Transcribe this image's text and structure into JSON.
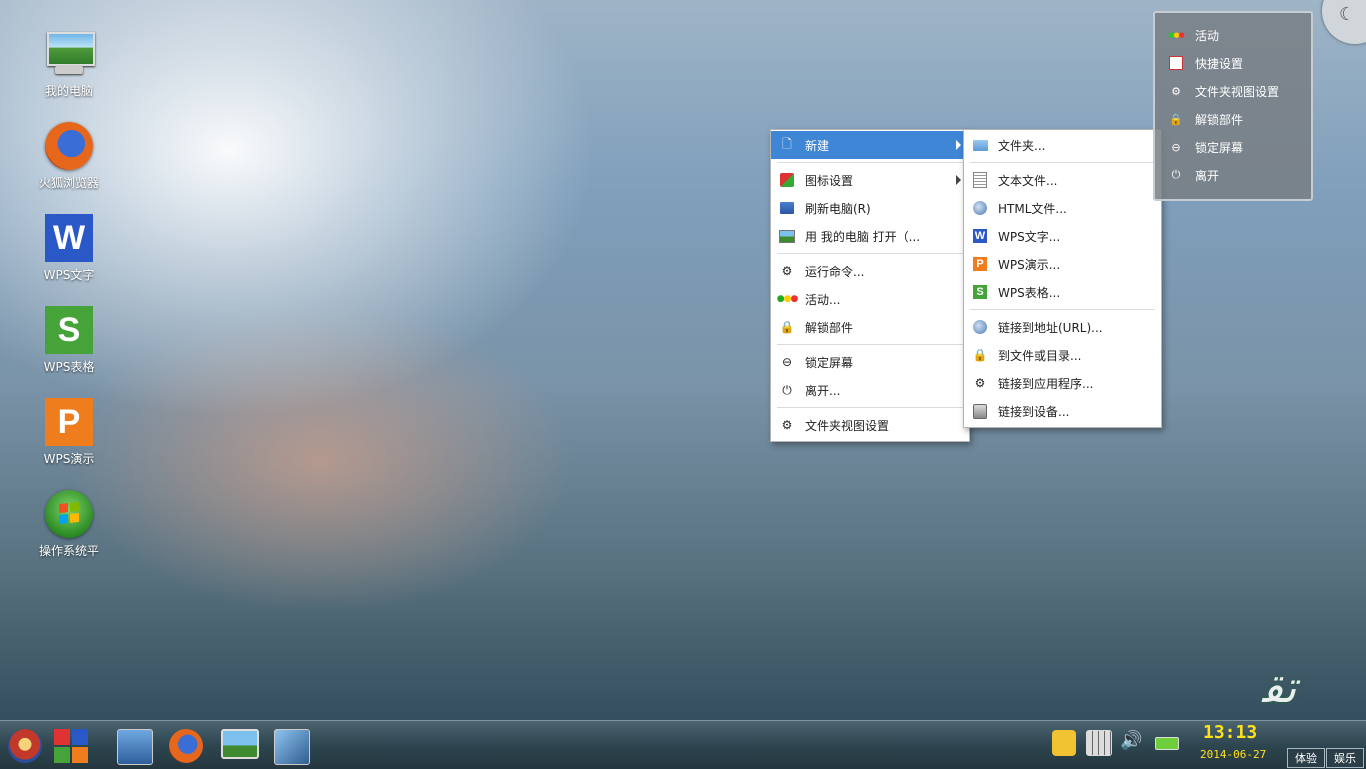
{
  "desktop": {
    "icons": [
      {
        "label": "我的电脑"
      },
      {
        "label": "火狐浏览器"
      },
      {
        "label": "WPS文字",
        "glyph": "W"
      },
      {
        "label": "WPS表格",
        "glyph": "S"
      },
      {
        "label": "WPS演示",
        "glyph": "P"
      },
      {
        "label": "操作系统平"
      }
    ]
  },
  "context_menu": {
    "items": [
      {
        "label": "新建",
        "icon": "new-doc-icon",
        "submenu": true,
        "active": true
      },
      {
        "label": "图标设置",
        "icon": "icon-settings-icon",
        "submenu": true
      },
      {
        "label": "刷新电脑(R)",
        "icon": "refresh-icon"
      },
      {
        "label": "用 我的电脑 打开（...",
        "icon": "monitor-icon"
      },
      {
        "label": "运行命令...",
        "icon": "gear-icon"
      },
      {
        "label": "活动...",
        "icon": "activity-dots-icon"
      },
      {
        "label": "解锁部件",
        "icon": "lock-icon"
      },
      {
        "label": "锁定屏幕",
        "icon": "lock-screen-icon"
      },
      {
        "label": "离开...",
        "icon": "power-icon"
      },
      {
        "label": "文件夹视图设置",
        "icon": "gear-icon"
      }
    ]
  },
  "submenu_new": {
    "items": [
      {
        "label": "文件夹...",
        "icon": "folder-icon"
      },
      {
        "label": "文本文件...",
        "icon": "text-file-icon"
      },
      {
        "label": "HTML文件...",
        "icon": "globe-icon"
      },
      {
        "label": "WPS文字...",
        "icon": "wps-writer-icon",
        "glyph": "W"
      },
      {
        "label": "WPS演示...",
        "icon": "wps-presentation-icon",
        "glyph": "P"
      },
      {
        "label": "WPS表格...",
        "icon": "wps-spreadsheet-icon",
        "glyph": "S"
      },
      {
        "label": "链接到地址(URL)...",
        "icon": "globe-icon"
      },
      {
        "label": "到文件或目录...",
        "icon": "lock-icon"
      },
      {
        "label": "链接到应用程序...",
        "icon": "gear-icon"
      },
      {
        "label": "链接到设备...",
        "icon": "drive-icon"
      }
    ]
  },
  "panel": {
    "items": [
      {
        "label": "活动",
        "icon": "activity-dots-icon"
      },
      {
        "label": "快捷设置",
        "icon": "quick-settings-icon"
      },
      {
        "label": "文件夹视图设置",
        "icon": "gear-icon"
      },
      {
        "label": "解锁部件",
        "icon": "lock-icon"
      },
      {
        "label": "锁定屏幕",
        "icon": "lock-screen-icon"
      },
      {
        "label": "离开",
        "icon": "power-icon"
      }
    ]
  },
  "taskbar": {
    "clock": "13:13",
    "date": "2014-06-27",
    "buttons": {
      "left": "体验",
      "right": "娱乐"
    },
    "colors": {
      "clock": "#ffe11a",
      "menu_active": "#3f86d6"
    }
  }
}
